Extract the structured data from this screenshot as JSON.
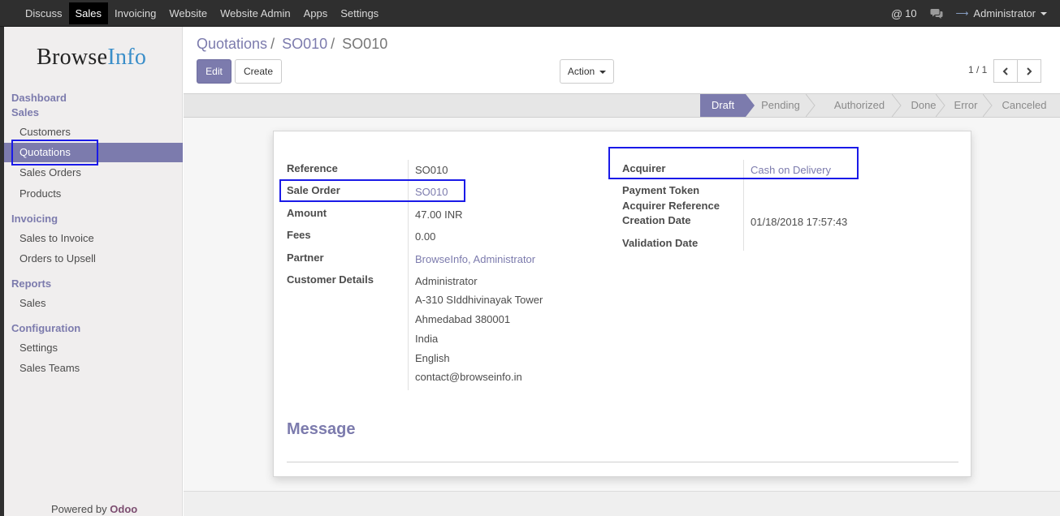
{
  "topbar": {
    "menu": [
      "Discuss",
      "Sales",
      "Invoicing",
      "Website",
      "Website Admin",
      "Apps",
      "Settings"
    ],
    "active_menu": "Sales",
    "mentions_count": "10",
    "user": "Administrator"
  },
  "sidebar": {
    "logo_part1": "Browse",
    "logo_part2": "Info",
    "dashboard": "Dashboard",
    "sales_head": "Sales",
    "sales_items": [
      "Customers",
      "Quotations",
      "Sales Orders",
      "Products"
    ],
    "invoicing_head": "Invoicing",
    "invoicing_items": [
      "Sales to Invoice",
      "Orders to Upsell"
    ],
    "reports_head": "Reports",
    "reports_items": [
      "Sales"
    ],
    "config_head": "Configuration",
    "config_items": [
      "Settings",
      "Sales Teams"
    ],
    "powered_by": "Powered by",
    "odoo": "Odoo"
  },
  "breadcrumb": {
    "level1": "Quotations",
    "level2": "SO010",
    "current": "SO010"
  },
  "buttons": {
    "edit": "Edit",
    "create": "Create",
    "action": "Action"
  },
  "pager": {
    "text": "1 / 1"
  },
  "stages": [
    "Draft",
    "Pending",
    "Authorized",
    "Done",
    "Error",
    "Canceled"
  ],
  "active_stage": "Draft",
  "form": {
    "left": {
      "reference_label": "Reference",
      "reference": "SO010",
      "sale_order_label": "Sale Order",
      "sale_order": "SO010",
      "amount_label": "Amount",
      "amount": "47.00 INR",
      "fees_label": "Fees",
      "fees": "0.00",
      "partner_label": "Partner",
      "partner": "BrowseInfo, Administrator",
      "customer_details_label": "Customer Details",
      "customer_details": [
        "Administrator",
        "A-310 SIddhivinayak Tower",
        "Ahmedabad 380001",
        "India",
        "English",
        "contact@browseinfo.in"
      ]
    },
    "right": {
      "acquirer_label": "Acquirer",
      "acquirer": "Cash on Delivery",
      "payment_token_label": "Payment Token",
      "acquirer_reference_label": "Acquirer Reference",
      "creation_date_label": "Creation Date",
      "creation_date": "01/18/2018 17:57:43",
      "validation_date_label": "Validation Date"
    },
    "message_title": "Message"
  }
}
